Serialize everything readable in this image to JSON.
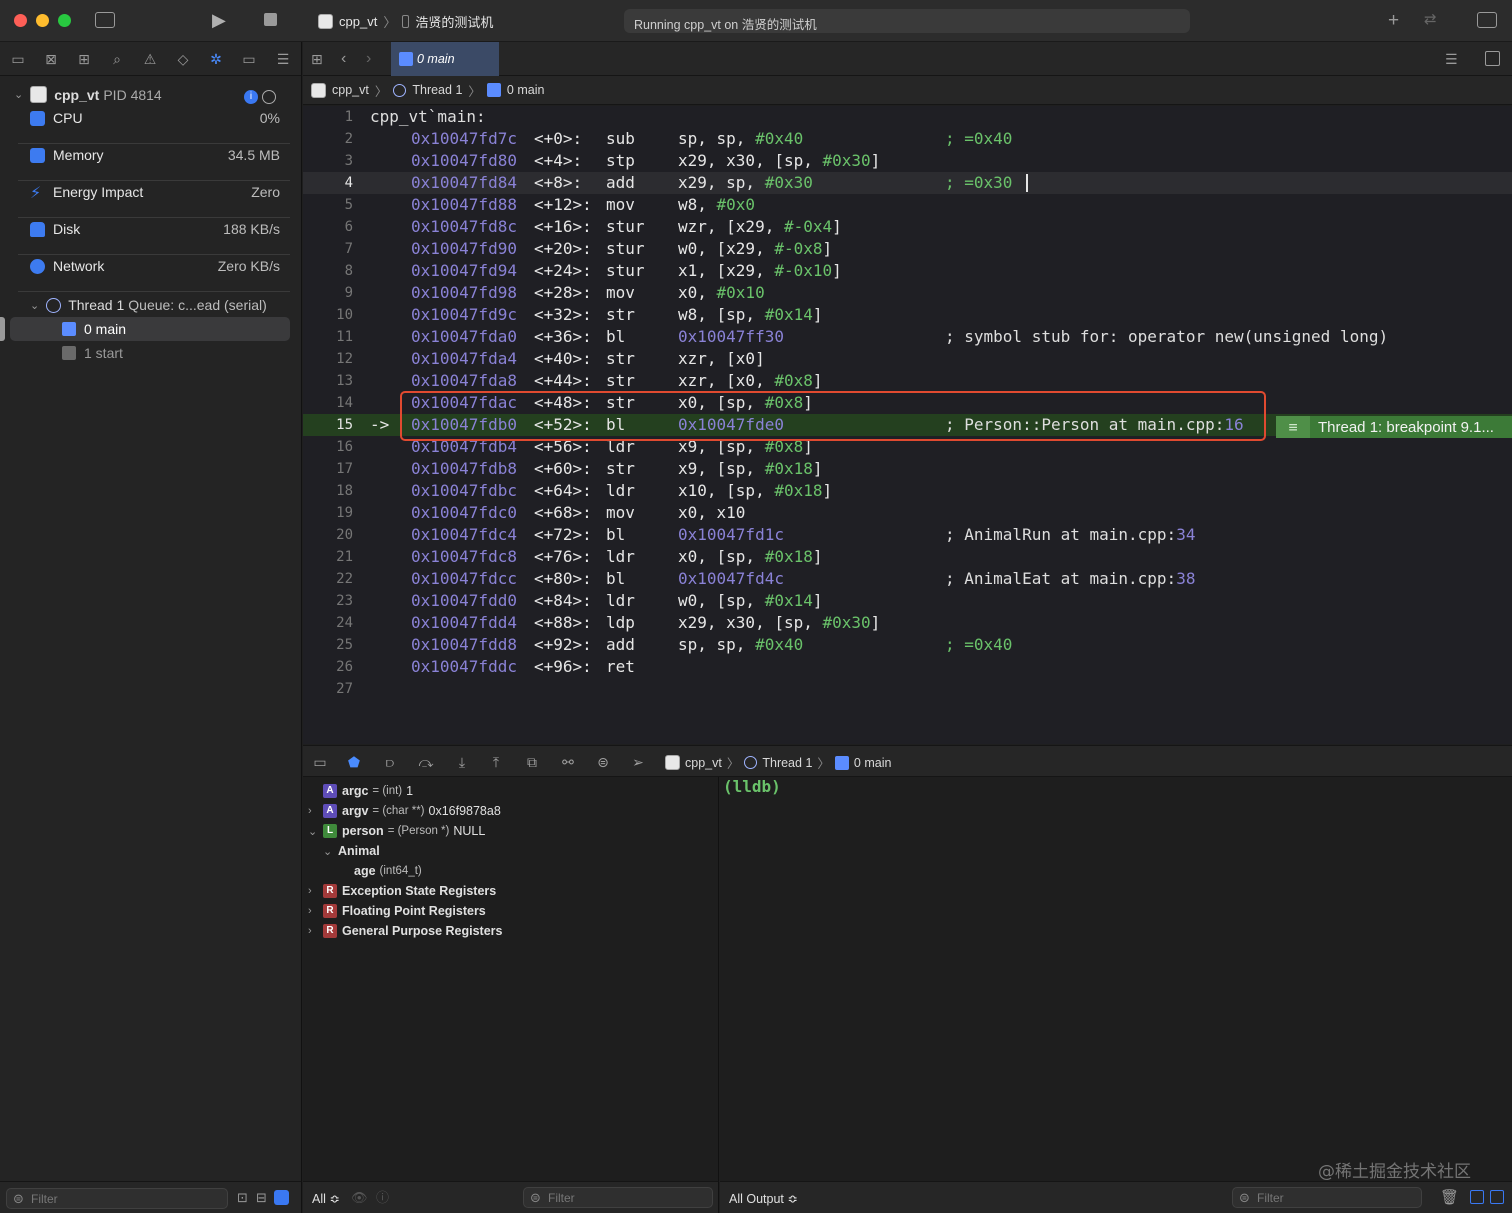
{
  "titlebar": {
    "scheme_target": "cpp_vt",
    "device": "浩贤的测试机",
    "status": "Running cpp_vt on 浩贤的测试机"
  },
  "tab": {
    "label": "0 main"
  },
  "jumpbar": {
    "project": "cpp_vt",
    "thread": "Thread 1",
    "frame": "0 main"
  },
  "navigator": {
    "process": {
      "name": "cpp_vt",
      "pid_label": "PID 4814"
    },
    "gauges": [
      {
        "label": "CPU",
        "value": "0%"
      },
      {
        "label": "Memory",
        "value": "34.5 MB"
      },
      {
        "label": "Energy Impact",
        "value": "Zero"
      },
      {
        "label": "Disk",
        "value": "188 KB/s"
      },
      {
        "label": "Network",
        "value": "Zero KB/s"
      }
    ],
    "thread": {
      "label": "Thread 1",
      "queue": "Queue: c...ead (serial)"
    },
    "frames": [
      {
        "label": "0 main"
      },
      {
        "label": "1 start"
      }
    ],
    "filter_placeholder": "Filter"
  },
  "editor": {
    "header": "cpp_vt`main:",
    "lines": [
      {
        "n": "2",
        "addr": "0x10047fd7c",
        "off": "<+0>:",
        "op": "sub",
        "args": [
          {
            "t": "sp, sp, "
          },
          {
            "t": "#0x40",
            "c": "num"
          }
        ],
        "comment": [
          {
            "t": "; =0x40",
            "c": "num"
          }
        ]
      },
      {
        "n": "3",
        "addr": "0x10047fd80",
        "off": "<+4>:",
        "op": "stp",
        "args": [
          {
            "t": "x29, x30, [sp, "
          },
          {
            "t": "#0x30",
            "c": "num"
          },
          {
            "t": "]"
          }
        ]
      },
      {
        "n": "4",
        "addr": "0x10047fd84",
        "off": "<+8>:",
        "op": "add",
        "args": [
          {
            "t": "x29, sp, "
          },
          {
            "t": "#0x30",
            "c": "num"
          }
        ],
        "comment": [
          {
            "t": "; =0x30",
            "c": "num"
          }
        ]
      },
      {
        "n": "5",
        "addr": "0x10047fd88",
        "off": "<+12>:",
        "op": "mov",
        "args": [
          {
            "t": "w8, "
          },
          {
            "t": "#0x0",
            "c": "num"
          }
        ]
      },
      {
        "n": "6",
        "addr": "0x10047fd8c",
        "off": "<+16>:",
        "op": "stur",
        "args": [
          {
            "t": "wzr, [x29, "
          },
          {
            "t": "#-0x4",
            "c": "num"
          },
          {
            "t": "]"
          }
        ]
      },
      {
        "n": "7",
        "addr": "0x10047fd90",
        "off": "<+20>:",
        "op": "stur",
        "args": [
          {
            "t": "w0, [x29, "
          },
          {
            "t": "#-0x8",
            "c": "num"
          },
          {
            "t": "]"
          }
        ]
      },
      {
        "n": "8",
        "addr": "0x10047fd94",
        "off": "<+24>:",
        "op": "stur",
        "args": [
          {
            "t": "x1, [x29, "
          },
          {
            "t": "#-0x10",
            "c": "num"
          },
          {
            "t": "]"
          }
        ]
      },
      {
        "n": "9",
        "addr": "0x10047fd98",
        "off": "<+28>:",
        "op": "mov",
        "args": [
          {
            "t": "x0, "
          },
          {
            "t": "#0x10",
            "c": "num"
          }
        ]
      },
      {
        "n": "10",
        "addr": "0x10047fd9c",
        "off": "<+32>:",
        "op": "str",
        "args": [
          {
            "t": "w8, [sp, "
          },
          {
            "t": "#0x14",
            "c": "num"
          },
          {
            "t": "]"
          }
        ]
      },
      {
        "n": "11",
        "addr": "0x10047fda0",
        "off": "<+36>:",
        "op": "bl",
        "args": [
          {
            "t": "0x10047ff30",
            "c": "addr"
          }
        ],
        "comment": [
          {
            "t": "; symbol stub for: operator new(unsigned long)",
            "c": "cmt"
          }
        ]
      },
      {
        "n": "12",
        "addr": "0x10047fda4",
        "off": "<+40>:",
        "op": "str",
        "args": [
          {
            "t": "xzr, [x0]"
          }
        ]
      },
      {
        "n": "13",
        "addr": "0x10047fda8",
        "off": "<+44>:",
        "op": "str",
        "args": [
          {
            "t": "xzr, [x0, "
          },
          {
            "t": "#0x8",
            "c": "num"
          },
          {
            "t": "]"
          }
        ]
      },
      {
        "n": "14",
        "addr": "0x10047fdac",
        "off": "<+48>:",
        "op": "str",
        "args": [
          {
            "t": "x0, [sp, "
          },
          {
            "t": "#0x8",
            "c": "num"
          },
          {
            "t": "]"
          }
        ]
      },
      {
        "n": "15",
        "addr": "0x10047fdb0",
        "off": "<+52>:",
        "op": "bl",
        "args": [
          {
            "t": "0x10047fde0",
            "c": "addr"
          }
        ],
        "comment": [
          {
            "t": "; Person::Person at main.cpp:",
            "c": "cmt"
          },
          {
            "t": "16",
            "c": "cmtnum"
          }
        ],
        "pc": "->"
      },
      {
        "n": "16",
        "addr": "0x10047fdb4",
        "off": "<+56>:",
        "op": "ldr",
        "args": [
          {
            "t": "x9, [sp, "
          },
          {
            "t": "#0x8",
            "c": "num"
          },
          {
            "t": "]"
          }
        ]
      },
      {
        "n": "17",
        "addr": "0x10047fdb8",
        "off": "<+60>:",
        "op": "str",
        "args": [
          {
            "t": "x9, [sp, "
          },
          {
            "t": "#0x18",
            "c": "num"
          },
          {
            "t": "]"
          }
        ]
      },
      {
        "n": "18",
        "addr": "0x10047fdbc",
        "off": "<+64>:",
        "op": "ldr",
        "args": [
          {
            "t": "x10, [sp, "
          },
          {
            "t": "#0x18",
            "c": "num"
          },
          {
            "t": "]"
          }
        ]
      },
      {
        "n": "19",
        "addr": "0x10047fdc0",
        "off": "<+68>:",
        "op": "mov",
        "args": [
          {
            "t": "x0, x10"
          }
        ]
      },
      {
        "n": "20",
        "addr": "0x10047fdc4",
        "off": "<+72>:",
        "op": "bl",
        "args": [
          {
            "t": "0x10047fd1c",
            "c": "addr"
          }
        ],
        "comment": [
          {
            "t": "; AnimalRun at main.cpp:",
            "c": "cmt"
          },
          {
            "t": "34",
            "c": "cmtnum"
          }
        ]
      },
      {
        "n": "21",
        "addr": "0x10047fdc8",
        "off": "<+76>:",
        "op": "ldr",
        "args": [
          {
            "t": "x0, [sp, "
          },
          {
            "t": "#0x18",
            "c": "num"
          },
          {
            "t": "]"
          }
        ]
      },
      {
        "n": "22",
        "addr": "0x10047fdcc",
        "off": "<+80>:",
        "op": "bl",
        "args": [
          {
            "t": "0x10047fd4c",
            "c": "addr"
          }
        ],
        "comment": [
          {
            "t": "; AnimalEat at main.cpp:",
            "c": "cmt"
          },
          {
            "t": "38",
            "c": "cmtnum"
          }
        ]
      },
      {
        "n": "23",
        "addr": "0x10047fdd0",
        "off": "<+84>:",
        "op": "ldr",
        "args": [
          {
            "t": "w0, [sp, "
          },
          {
            "t": "#0x14",
            "c": "num"
          },
          {
            "t": "]"
          }
        ]
      },
      {
        "n": "24",
        "addr": "0x10047fdd4",
        "off": "<+88>:",
        "op": "ldp",
        "args": [
          {
            "t": "x29, x30, [sp, "
          },
          {
            "t": "#0x30",
            "c": "num"
          },
          {
            "t": "]"
          }
        ]
      },
      {
        "n": "25",
        "addr": "0x10047fdd8",
        "off": "<+92>:",
        "op": "add",
        "args": [
          {
            "t": "sp, sp, "
          },
          {
            "t": "#0x40",
            "c": "num"
          }
        ],
        "comment": [
          {
            "t": "; =0x40",
            "c": "num"
          }
        ]
      },
      {
        "n": "26",
        "addr": "0x10047fddc",
        "off": "<+96>:",
        "op": "ret",
        "args": []
      },
      {
        "n": "27"
      }
    ],
    "first_line_number": "1",
    "breakpoint_badge": "Thread 1: breakpoint 9.1..."
  },
  "debugbar": {
    "project": "cpp_vt",
    "thread": "Thread 1",
    "frame": "0 main"
  },
  "variables": [
    {
      "badge": "A",
      "name": "argc",
      "type": "= (int)",
      "value": "1",
      "indent": 0,
      "disclosure": ""
    },
    {
      "badge": "A",
      "name": "argv",
      "type": "= (char **)",
      "value": "0x16f9878a8",
      "indent": 0,
      "disclosure": ">"
    },
    {
      "badge": "L",
      "name": "person",
      "type": "= (Person *)",
      "value": "NULL",
      "indent": 0,
      "disclosure": "v"
    },
    {
      "badge": "",
      "name": "Animal",
      "type": "",
      "value": "",
      "indent": 1,
      "disclosure": "v"
    },
    {
      "badge": "",
      "name": "age",
      "type": "(int64_t)",
      "value": "",
      "indent": 2,
      "disclosure": ""
    },
    {
      "badge": "R",
      "name": "Exception State Registers",
      "type": "",
      "value": "",
      "indent": 0,
      "disclosure": ">"
    },
    {
      "badge": "R",
      "name": "Floating Point Registers",
      "type": "",
      "value": "",
      "indent": 0,
      "disclosure": ">"
    },
    {
      "badge": "R",
      "name": "General Purpose Registers",
      "type": "",
      "value": "",
      "indent": 0,
      "disclosure": ">"
    }
  ],
  "console": {
    "prompt": "(lldb)",
    "watermark": "@稀土掘金技术社区"
  },
  "bottom": {
    "scope": "All ≎",
    "var_filter": "Filter",
    "output": "All Output ≎",
    "console_filter": "Filter"
  },
  "colors": {
    "pc_line": "#24401f",
    "breakpoint": "#3c7a37",
    "highlight_box": "#e04a30",
    "tab": "#3b4a66"
  }
}
